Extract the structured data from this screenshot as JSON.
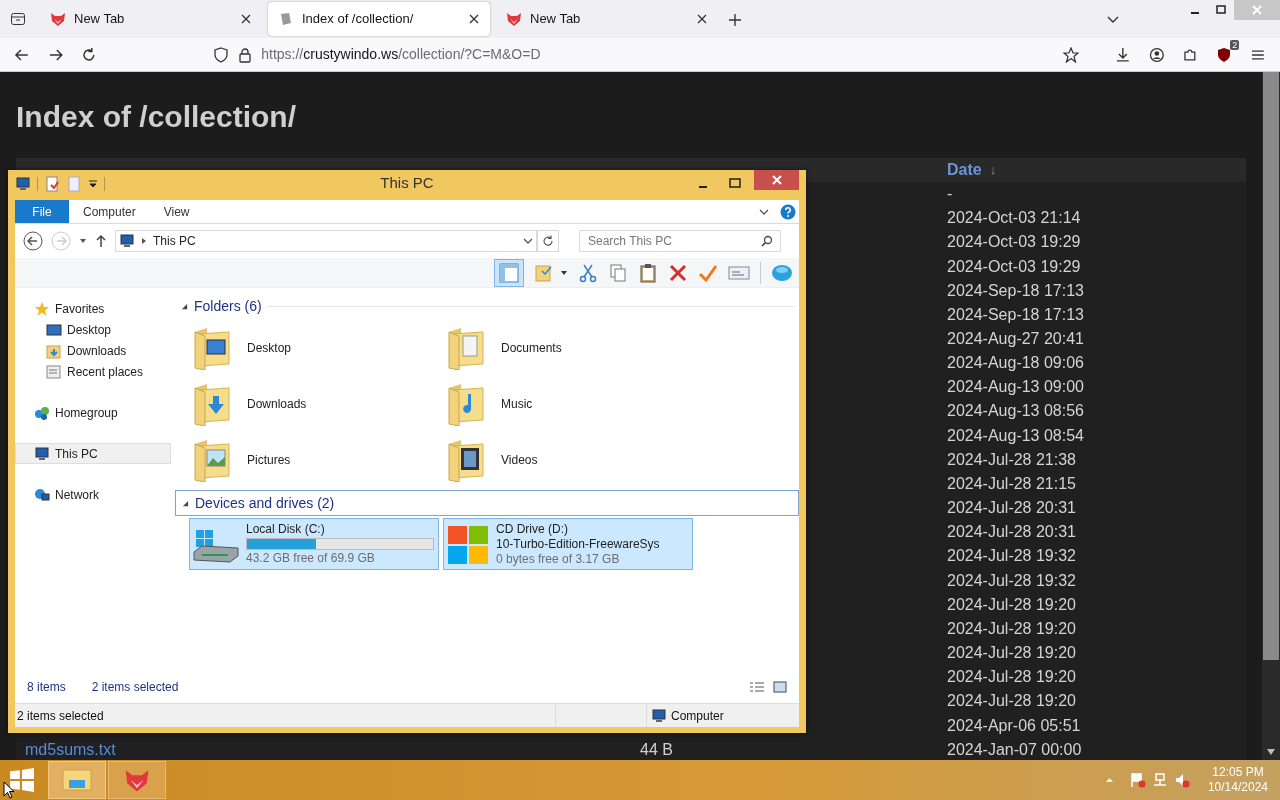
{
  "browser": {
    "tabs": [
      {
        "title": "New Tab",
        "selected": false
      },
      {
        "title": "Index of /collection/",
        "selected": true
      },
      {
        "title": "New Tab",
        "selected": false
      }
    ],
    "url": {
      "scheme": "https://",
      "host": "crustywindo.ws",
      "path": "/collection/?C=M&O=D"
    },
    "extension_badge": "2"
  },
  "page": {
    "heading": "Index of /collection/",
    "date_header": "Date",
    "sort_mark": "↓",
    "rows": [
      {
        "date": "-"
      },
      {
        "date": "2024-Oct-03 21:14"
      },
      {
        "date": "2024-Oct-03 19:29"
      },
      {
        "date": "2024-Oct-03 19:29"
      },
      {
        "date": "2024-Sep-18 17:13"
      },
      {
        "date": "2024-Sep-18 17:13"
      },
      {
        "date": "2024-Aug-27 20:41"
      },
      {
        "date": "2024-Aug-18 09:06"
      },
      {
        "date": "2024-Aug-13 09:00"
      },
      {
        "date": "2024-Aug-13 08:56"
      },
      {
        "date": "2024-Aug-13 08:54"
      },
      {
        "date": "2024-Jul-28 21:38"
      },
      {
        "date": "2024-Jul-28 21:15"
      },
      {
        "date": "2024-Jul-28 20:31"
      },
      {
        "date": "2024-Jul-28 20:31"
      },
      {
        "date": "2024-Jul-28 19:32"
      },
      {
        "date": "2024-Jul-28 19:32"
      },
      {
        "date": "2024-Jul-28 19:20"
      },
      {
        "date": "2024-Jul-28 19:20"
      },
      {
        "date": "2024-Jul-28 19:20"
      },
      {
        "date": "2024-Jul-28 19:20"
      },
      {
        "date": "2024-Jul-28 19:20"
      },
      {
        "date": "2024-Apr-06 05:51"
      },
      {
        "name": "md5sums.txt",
        "size": "44 B",
        "date": "2024-Jan-07 00:00"
      }
    ]
  },
  "explorer": {
    "title": "This PC",
    "ribbon_tabs": [
      {
        "label": "File",
        "kind": "menu"
      },
      {
        "label": "Computer",
        "kind": "tab"
      },
      {
        "label": "View",
        "kind": "tab"
      }
    ],
    "address": "This PC",
    "search_placeholder": "Search This PC",
    "nav": [
      {
        "label": "Favorites",
        "kind": "star",
        "selected": false,
        "children": [
          {
            "label": "Desktop",
            "kind": "desktop",
            "selected": false
          },
          {
            "label": "Downloads",
            "kind": "downloads",
            "selected": false
          },
          {
            "label": "Recent places",
            "kind": "recent",
            "selected": false
          }
        ]
      },
      {
        "label": "Homegroup",
        "kind": "homegroup",
        "selected": false
      },
      {
        "label": "This PC",
        "kind": "pc",
        "selected": true
      },
      {
        "label": "Network",
        "kind": "network",
        "selected": false
      }
    ],
    "folders_header": "Folders (6)",
    "folders": [
      {
        "name": "Desktop",
        "kind": "desktop"
      },
      {
        "name": "Documents",
        "kind": "documents"
      },
      {
        "name": "Downloads",
        "kind": "downloads"
      },
      {
        "name": "Music",
        "kind": "music"
      },
      {
        "name": "Pictures",
        "kind": "pictures"
      },
      {
        "name": "Videos",
        "kind": "videos"
      }
    ],
    "drives_header": "Devices and drives (2)",
    "drives": [
      {
        "name": "Local Disk (C:)",
        "kind": "disk",
        "level": 0.37,
        "free": "43.2 GB free of 69.9 GB",
        "selected": true
      },
      {
        "name": "CD Drive (D:)",
        "kind": "optical",
        "volume": "10-Turbo-Edition-FreewareSys",
        "free": "0 bytes free of 3.17 GB",
        "selected": true
      }
    ],
    "item_count": "8 items",
    "selection_count": "2 items selected",
    "status_text": "2 items selected",
    "status_location": "Computer"
  },
  "taskbar": {
    "time": "12:05 PM",
    "date": "10/14/2024"
  }
}
